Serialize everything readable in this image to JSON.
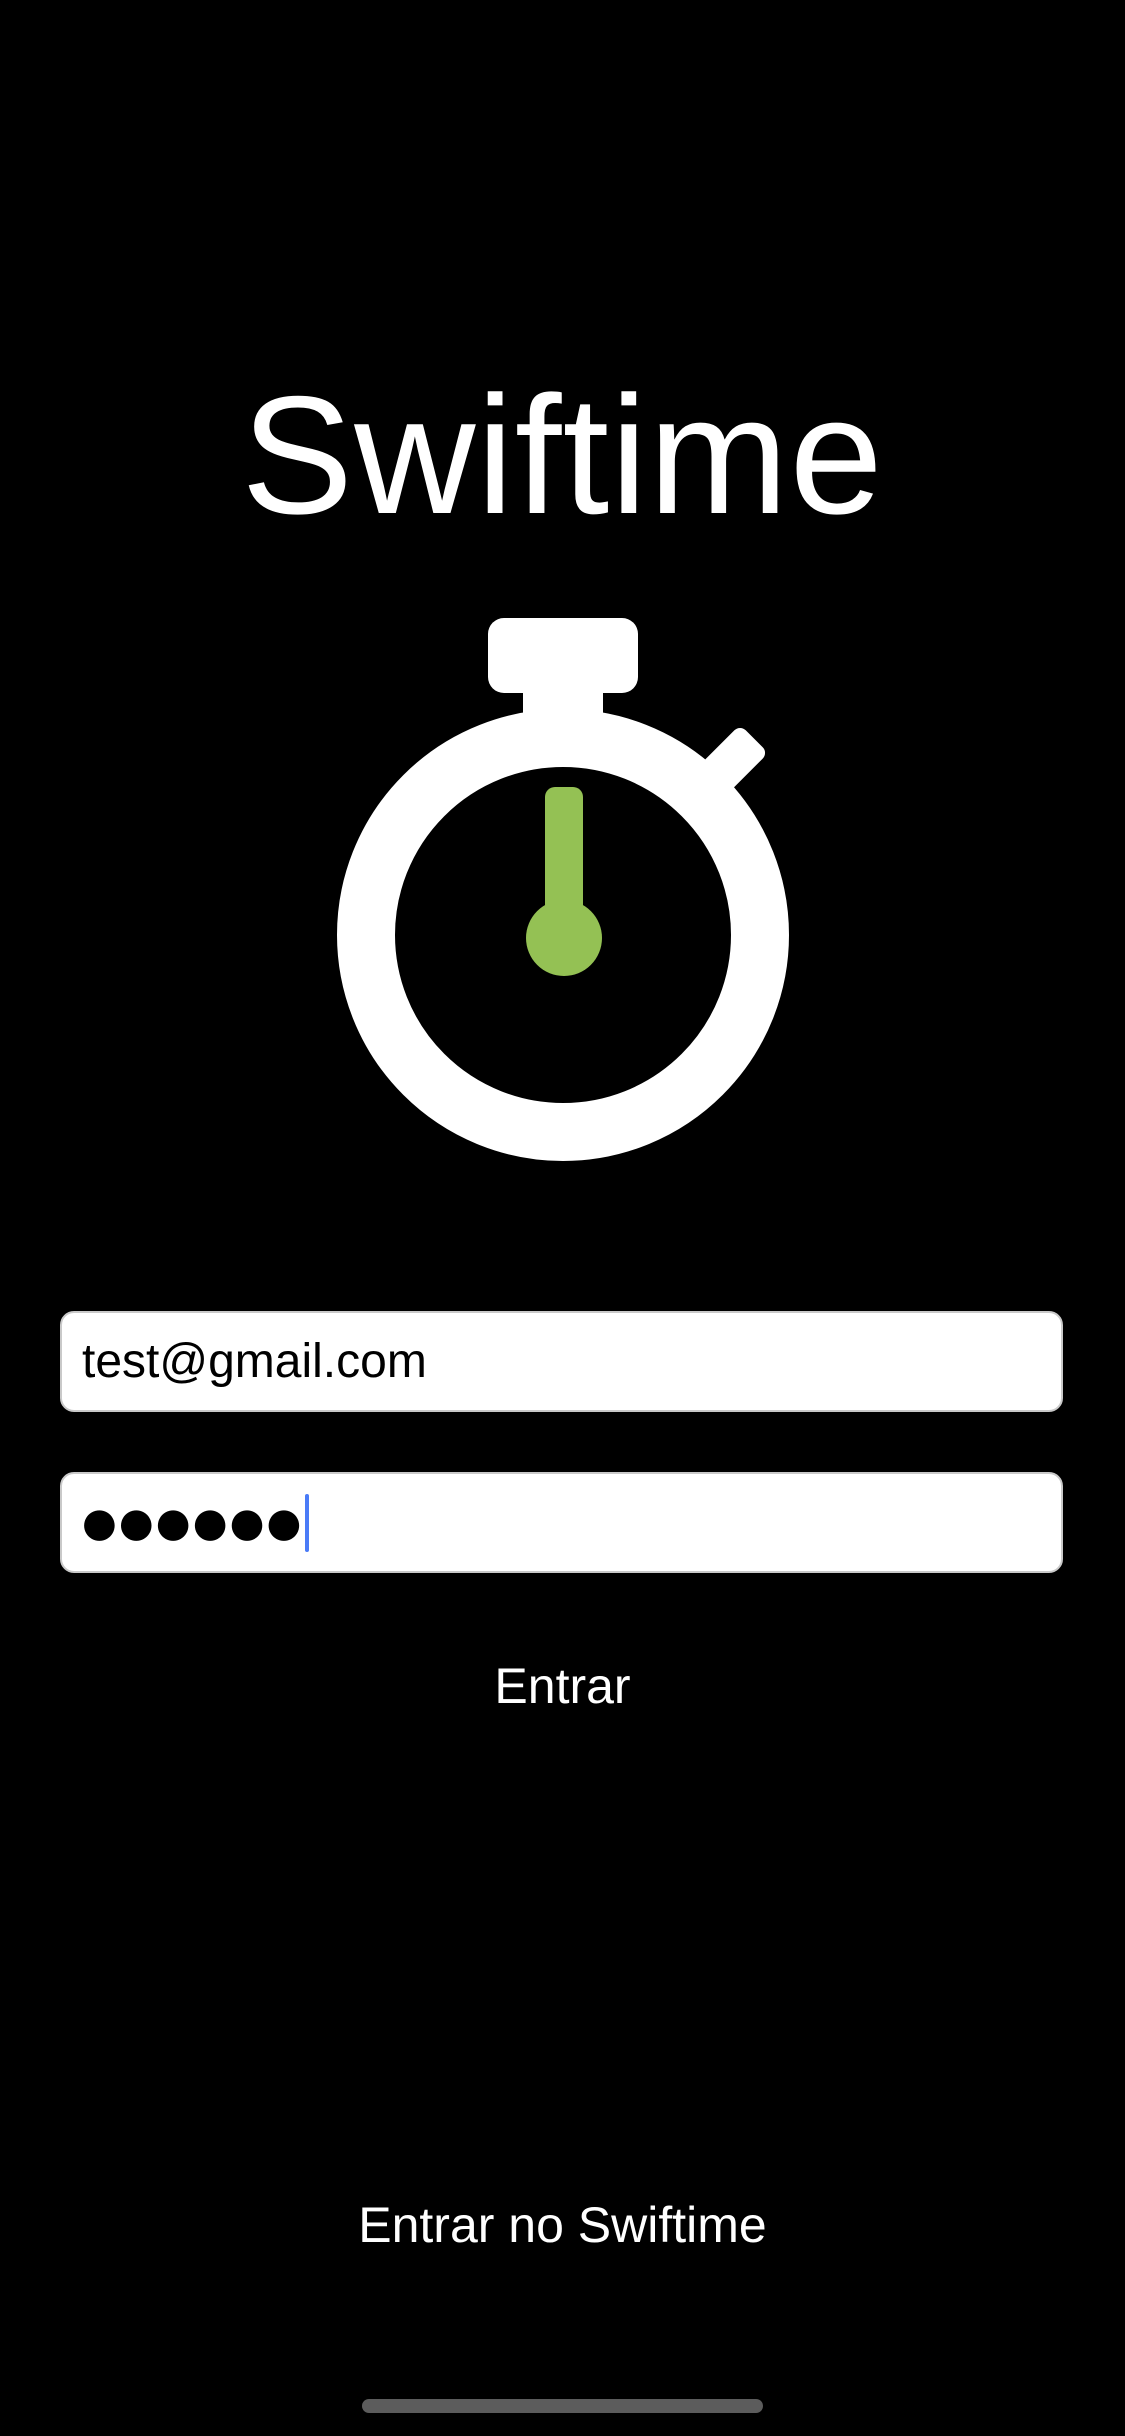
{
  "app": {
    "title": "Swiftime"
  },
  "logo": {
    "icon": "stopwatch-icon",
    "hand_color": "#94c154",
    "body_color": "#ffffff"
  },
  "form": {
    "email_value": "test@gmail.com",
    "password_value": "●●●●●●"
  },
  "actions": {
    "login_label": "Entrar",
    "signin_label": "Entrar no Swiftime"
  },
  "colors": {
    "background": "#000000",
    "caret": "#4a7bf7"
  }
}
